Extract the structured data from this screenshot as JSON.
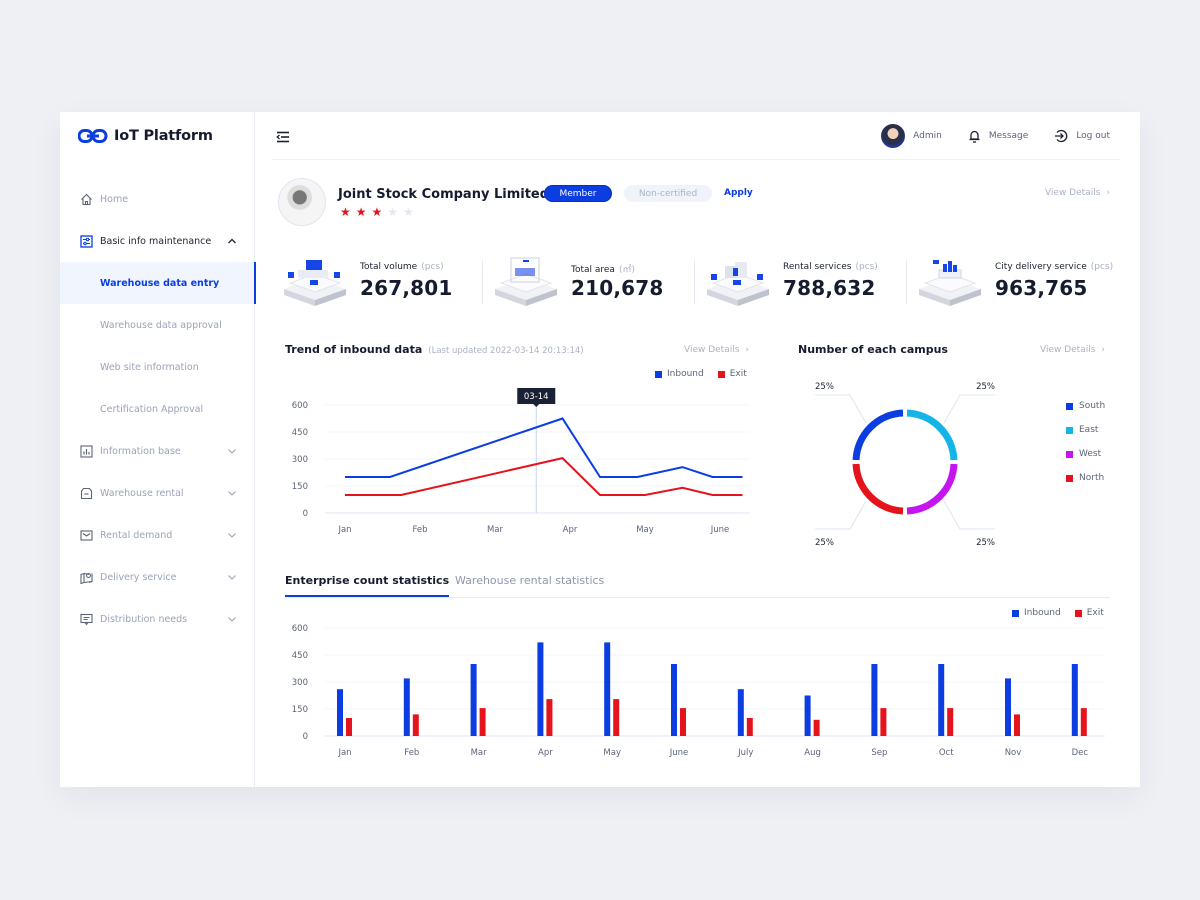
{
  "app": {
    "title": "IoT Platform"
  },
  "sidebar": {
    "items": [
      {
        "label": "Home",
        "icon": "home-icon",
        "type": "item"
      },
      {
        "label": "Basic info maintenance",
        "icon": "sliders-icon",
        "type": "parent-open"
      },
      {
        "label": "Warehouse data entry",
        "type": "sub-active"
      },
      {
        "label": "Warehouse data approval",
        "type": "sub"
      },
      {
        "label": "Web site information",
        "type": "sub"
      },
      {
        "label": "Certification Approval",
        "type": "sub"
      },
      {
        "label": "Information base",
        "icon": "bar-chart-icon",
        "type": "parent"
      },
      {
        "label": "Warehouse rental",
        "icon": "warehouse-icon",
        "type": "parent"
      },
      {
        "label": "Rental demand",
        "icon": "mail-icon",
        "type": "parent"
      },
      {
        "label": "Delivery service",
        "icon": "map-pin-icon",
        "type": "parent"
      },
      {
        "label": "Distribution needs",
        "icon": "message-icon",
        "type": "parent"
      }
    ]
  },
  "header": {
    "user_name": "Admin",
    "message_label": "Message",
    "logout_label": "Log out"
  },
  "company": {
    "name": "Joint Stock Company Limited",
    "rating": 3,
    "rating_max": 5,
    "member_badge": "Member",
    "cert_badge": "Non-certified",
    "apply_label": "Apply",
    "view_details": "View Details"
  },
  "stats": [
    {
      "label": "Total volume",
      "unit": "(pcs)",
      "value": "267,801"
    },
    {
      "label": "Total area",
      "unit": "(㎡)",
      "value": "210,678"
    },
    {
      "label": "Rental services",
      "unit": "(pcs)",
      "value": "788,632"
    },
    {
      "label": "City delivery service",
      "unit": "(pcs)",
      "value": "963,765"
    }
  ],
  "trend": {
    "title": "Trend of inbound data",
    "subtitle": "(Last updated  2022-03-14 20:13:14)",
    "view_details": "View Details",
    "tooltip": "03-14"
  },
  "campus": {
    "title": "Number of each campus",
    "view_details": "View Details"
  },
  "tabs": [
    {
      "label": "Enterprise count statistics",
      "active": true
    },
    {
      "label": "Warehouse rental statistics",
      "active": false
    }
  ],
  "colors": {
    "primary": "#0b3de0",
    "inbound": "#0b3de0",
    "exit": "#e5131c",
    "south": "#0b3de0",
    "east": "#14b4e6",
    "west": "#c414f0",
    "north": "#e5131c"
  },
  "chart_data": [
    {
      "type": "line",
      "title": "Trend of inbound data",
      "x": [
        "Jan",
        "Feb",
        "Mar",
        "Apr",
        "May",
        "June"
      ],
      "ylim": [
        0,
        600
      ],
      "yticks": [
        0,
        150,
        300,
        450,
        600
      ],
      "grid": true,
      "legend": "top-right",
      "series": [
        {
          "name": "Inbound",
          "color": "#0b3de0",
          "points": [
            [
              0,
              200
            ],
            [
              0.6,
              200
            ],
            [
              2.9,
              525
            ],
            [
              3.4,
              200
            ],
            [
              3.9,
              200
            ],
            [
              4.5,
              255
            ],
            [
              4.9,
              200
            ],
            [
              5.3,
              200
            ]
          ]
        },
        {
          "name": "Exit",
          "color": "#e5131c",
          "points": [
            [
              0,
              100
            ],
            [
              0.75,
              100
            ],
            [
              2.9,
              305
            ],
            [
              3.4,
              100
            ],
            [
              4.0,
              100
            ],
            [
              4.5,
              140
            ],
            [
              4.9,
              100
            ],
            [
              5.3,
              100
            ]
          ]
        }
      ],
      "marker_label": "03-14",
      "marker_x": 2.55
    },
    {
      "type": "pie",
      "title": "Number of each campus",
      "legend": "right",
      "slices": [
        {
          "name": "South",
          "value": 25,
          "label": "25%",
          "color": "#0b3de0"
        },
        {
          "name": "East",
          "value": 25,
          "label": "25%",
          "color": "#14b4e6"
        },
        {
          "name": "West",
          "value": 25,
          "label": "25%",
          "color": "#c414f0"
        },
        {
          "name": "North",
          "value": 25,
          "label": "25%",
          "color": "#e5131c"
        }
      ]
    },
    {
      "type": "bar",
      "title": "Enterprise count statistics",
      "categories": [
        "Jan",
        "Feb",
        "Mar",
        "Apr",
        "May",
        "June",
        "July",
        "Aug",
        "Sep",
        "Oct",
        "Nov",
        "Dec"
      ],
      "ylim": [
        0,
        600
      ],
      "yticks": [
        0,
        150,
        300,
        450,
        600
      ],
      "grid": true,
      "legend": "top-right",
      "series": [
        {
          "name": "Inbound",
          "color": "#0b3de0",
          "values": [
            260,
            320,
            400,
            520,
            520,
            400,
            260,
            225,
            400,
            400,
            320,
            400
          ]
        },
        {
          "name": "Exit",
          "color": "#e5131c",
          "values": [
            100,
            120,
            155,
            205,
            205,
            155,
            100,
            90,
            155,
            155,
            120,
            155
          ]
        }
      ]
    }
  ]
}
